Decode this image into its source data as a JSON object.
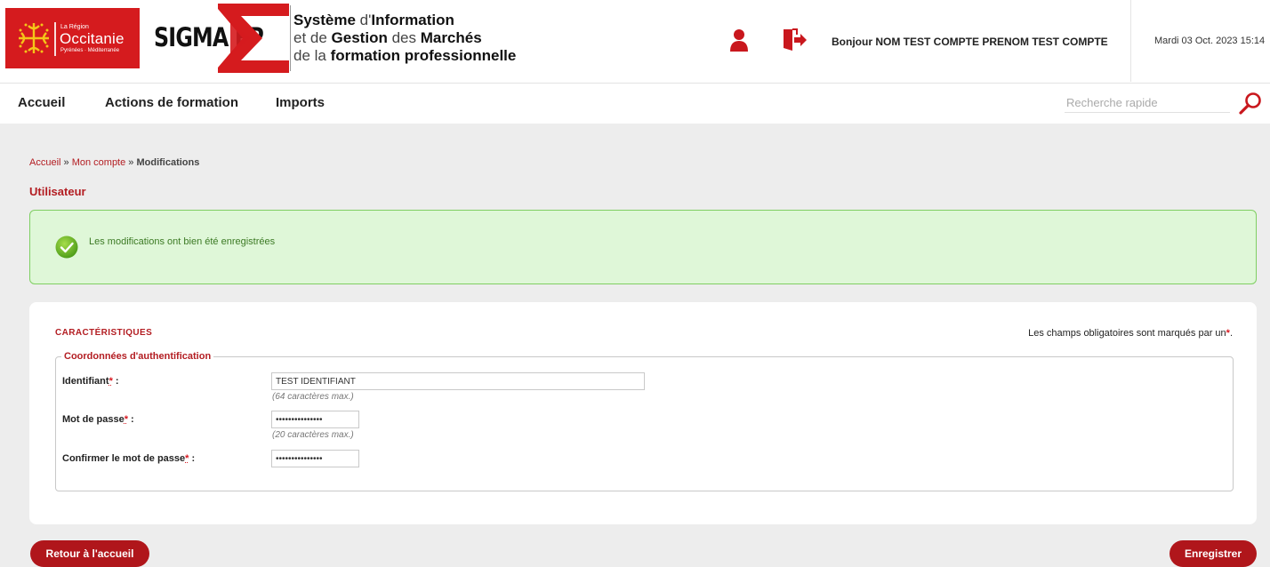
{
  "header": {
    "region_logo": {
      "small": "La Région",
      "name": "Occitanie",
      "sub": "Pyrénées · Méditerranée"
    },
    "app_logo_text": "SIGMA FP",
    "system_title": {
      "line1": [
        {
          "text": "Système",
          "style": "bold"
        },
        {
          "text": " d'",
          "style": "light"
        },
        {
          "text": "Information",
          "style": "bold"
        }
      ],
      "line2": [
        {
          "text": "et de ",
          "style": "light"
        },
        {
          "text": "Gestion",
          "style": "bold"
        },
        {
          "text": " des ",
          "style": "light"
        },
        {
          "text": "Marchés",
          "style": "bold"
        }
      ],
      "line3": [
        {
          "text": "de la ",
          "style": "light"
        },
        {
          "text": "formation professionnelle",
          "style": "bold"
        }
      ]
    },
    "greeting": "Bonjour NOM TEST COMPTE PRENOM TEST COMPTE",
    "date": "Mardi 03 Oct. 2023 15:14",
    "brand_color": "#d51b1e"
  },
  "nav": {
    "items": [
      "Accueil",
      "Actions de formation",
      "Imports"
    ],
    "search_placeholder": "Recherche rapide"
  },
  "breadcrumb": {
    "home": "Accueil",
    "sep": " » ",
    "account": "Mon compte",
    "current": "Modifications"
  },
  "page_title": "Utilisateur",
  "success_message": "Les modifications ont bien été enregistrées",
  "form": {
    "section_title": "CARACTÉRISTIQUES",
    "required_note": "Les champs obligatoires sont marqués par un",
    "required_star": "*",
    "fieldset_legend": "Coordonnées d'authentification",
    "fields": [
      {
        "label": "Identifiant",
        "value": "TEST IDENTIFIANT",
        "hint": "(64 caractères max.)",
        "type": "text"
      },
      {
        "label": "Mot de passe",
        "value": "passwordpasswor",
        "hint": "(20 caractères max.)",
        "type": "password"
      },
      {
        "label": "Confirmer le mot de passe",
        "value": "passwordpasswor",
        "hint": "",
        "type": "password"
      }
    ],
    "label_suffix": " :"
  },
  "buttons": {
    "back": "Retour à l'accueil",
    "save": "Enregistrer"
  },
  "colors": {
    "accent": "#b31d22",
    "success_bg": "#dff7d8",
    "success_border": "#7fcf62"
  }
}
